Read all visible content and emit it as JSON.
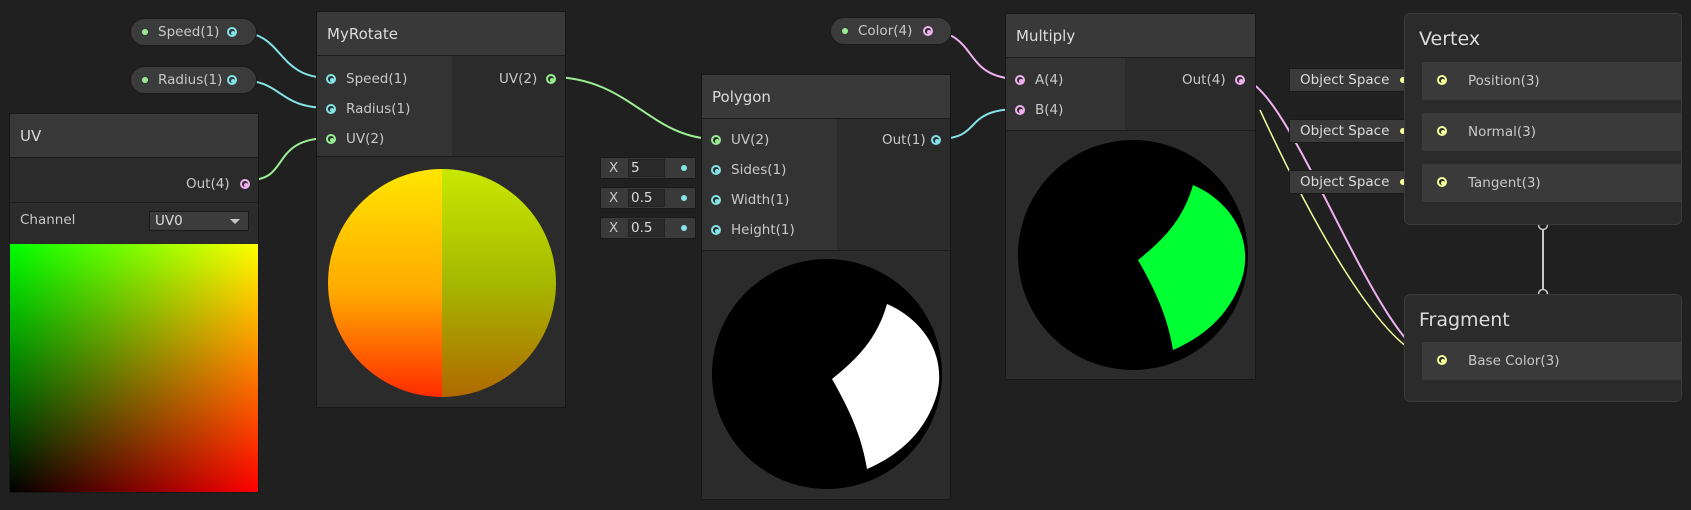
{
  "properties": {
    "speed": {
      "label": "Speed(1)"
    },
    "radius": {
      "label": "Radius(1)"
    },
    "color": {
      "label": "Color(4)"
    }
  },
  "nodes": {
    "uv": {
      "title": "UV",
      "out_label": "Out(4)",
      "channel_label": "Channel",
      "channel_value": "UV0"
    },
    "myrotate": {
      "title": "MyRotate",
      "inputs": [
        "Speed(1)",
        "Radius(1)",
        "UV(2)"
      ],
      "output": "UV(2)"
    },
    "polygon": {
      "title": "Polygon",
      "inputs": [
        "UV(2)",
        "Sides(1)",
        "Width(1)",
        "Height(1)"
      ],
      "output": "Out(1)",
      "inline_fields": [
        {
          "axis": "X",
          "value": "5"
        },
        {
          "axis": "X",
          "value": "0.5"
        },
        {
          "axis": "X",
          "value": "0.5"
        }
      ]
    },
    "multiply": {
      "title": "Multiply",
      "inputs": [
        "A(4)",
        "B(4)"
      ],
      "output": "Out(4)"
    }
  },
  "master": {
    "vertex": {
      "title": "Vertex",
      "rows": [
        {
          "label": "Position(3)",
          "space": "Object Space"
        },
        {
          "label": "Normal(3)",
          "space": "Object Space"
        },
        {
          "label": "Tangent(3)",
          "space": "Object Space"
        }
      ]
    },
    "fragment": {
      "title": "Fragment",
      "rows": [
        {
          "label": "Base Color(3)"
        }
      ]
    }
  },
  "colors": {
    "background": "#202020",
    "float_port": "#84e4e7",
    "vector2_port": "#9aef92",
    "vector4_port": "#f1b1f1",
    "vector3_port": "#f6ff9a",
    "multiply_preview_fill": "#00ff33",
    "polygon_preview_fill": "#ffffff"
  }
}
